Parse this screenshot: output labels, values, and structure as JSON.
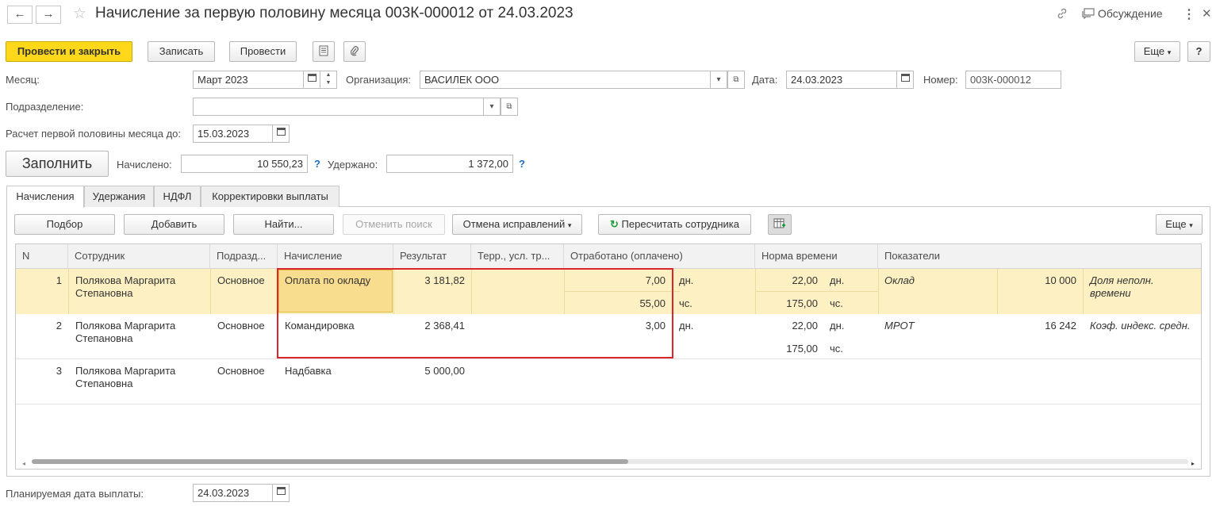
{
  "header": {
    "title": "Начисление за первую половину месяца 003К-000012 от 24.03.2023",
    "back_icon": "←",
    "forward_icon": "→",
    "star_icon": "☆",
    "link_icon": "🔗",
    "discussion_label": "Обсуждение",
    "more_icon": "⋮",
    "close_icon": "✕"
  },
  "toolbar": {
    "post_close": "Провести и закрыть",
    "save": "Записать",
    "post": "Провести",
    "more": "Еще",
    "help": "?"
  },
  "form": {
    "month_label": "Месяц:",
    "month_value": "Март 2023",
    "org_label": "Организация:",
    "org_value": "ВАСИЛЕК ООО",
    "date_label": "Дата:",
    "date_value": "24.03.2023",
    "number_label": "Номер:",
    "number_value": "003К-000012",
    "division_label": "Подразделение:",
    "division_value": "",
    "calc_label": "Расчет первой половины месяца до:",
    "calc_value": "15.03.2023",
    "fill_button": "Заполнить",
    "accrued_label": "Начислено:",
    "accrued_value": "10 550,23",
    "withheld_label": "Удержано:",
    "withheld_value": "1 372,00",
    "help_mark": "?"
  },
  "tabs": [
    "Начисления",
    "Удержания",
    "НДФЛ",
    "Корректировки выплаты"
  ],
  "table_toolbar": {
    "pick": "Подбор",
    "add": "Добавить",
    "find": "Найти...",
    "cancel_search": "Отменить поиск",
    "cancel_fix": "Отмена исправлений",
    "recalc": "Пересчитать сотрудника",
    "more": "Еще"
  },
  "columns": [
    "N",
    "Сотрудник",
    "Подразд...",
    "Начисление",
    "Результат",
    "Терр., усл. тр...",
    "Отработано (оплачено)",
    "Норма времени",
    "Показатели"
  ],
  "rows": [
    {
      "n": "1",
      "employee1": "Полякова Маргарита",
      "employee2": "Степановна",
      "division": "Основное",
      "accrual": "Оплата по окладу",
      "result": "3 181,82",
      "worked1": "7,00",
      "unit1": "дн.",
      "worked2": "55,00",
      "unit2": "чс.",
      "norm1": "22,00",
      "nunit1": "дн.",
      "norm2": "175,00",
      "nunit2": "чс.",
      "indicator": "Оклад",
      "ind_value": "10 000",
      "extra1": "Доля неполн.",
      "extra2": "времени"
    },
    {
      "n": "2",
      "employee1": "Полякова Маргарита",
      "employee2": "Степановна",
      "division": "Основное",
      "accrual": "Командировка",
      "result": "2 368,41",
      "worked1": "3,00",
      "unit1": "дн.",
      "norm1": "22,00",
      "nunit1": "дн.",
      "norm2": "175,00",
      "nunit2": "чс.",
      "indicator": "МРОТ",
      "ind_value": "16 242",
      "extra1": "Коэф. индекс. средн."
    },
    {
      "n": "3",
      "employee1": "Полякова Маргарита",
      "employee2": "Степановна",
      "division": "Основное",
      "accrual": "Надбавка",
      "result": "5 000,00"
    }
  ],
  "footer": {
    "pay_date_label": "Планируемая дата выплаты:",
    "pay_date_value": "24.03.2023"
  },
  "colors": {
    "accent_yellow": "#ffd81b",
    "row_highlight": "#fdf1c4",
    "selected_cell": "#f9dd8f",
    "red_frame": "#d9262c",
    "help_blue": "#1b6ec2",
    "recalc_green": "#1f9e3a"
  }
}
